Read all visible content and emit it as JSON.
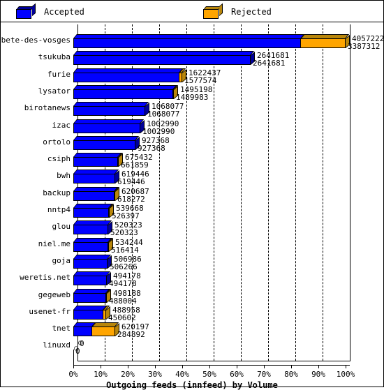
{
  "legend": {
    "items": [
      {
        "label": "Accepted",
        "color": "#0000ff",
        "side_color": "#000099",
        "icon": "cube-icon"
      },
      {
        "label": "Rejected",
        "color": "#ffa500",
        "side_color": "#b8860b",
        "icon": "cube-icon"
      }
    ]
  },
  "chart_data": {
    "type": "bar",
    "orientation": "horizontal",
    "stacked": false,
    "title": "",
    "xlabel": "Outgoing feeds (innfeed) by Volume",
    "ylabel": "",
    "xticks": [
      "0%",
      "10%",
      "20%",
      "30%",
      "40%",
      "50%",
      "60%",
      "70%",
      "80%",
      "90%",
      "100%"
    ],
    "xtick_values": [
      0,
      10,
      20,
      30,
      40,
      50,
      60,
      70,
      80,
      90,
      100
    ],
    "xlim": [
      0,
      100
    ],
    "grid": true,
    "legend_position": "top",
    "scale_reference": 4057222,
    "categories": [
      "bete-des-vosges",
      "tsukuba",
      "furie",
      "lysator",
      "birotanews",
      "izac",
      "ortolo",
      "csiph",
      "bwh",
      "backup",
      "nntp4",
      "glou",
      "niel.me",
      "goja",
      "weretis.net",
      "gegeweb",
      "usenet-fr",
      "tnet",
      "linuxd"
    ],
    "series": [
      {
        "name": "Accepted",
        "color": "#0000ff",
        "values": [
          4057222,
          2641681,
          1622437,
          1495198,
          1068077,
          1002990,
          927368,
          675432,
          619446,
          620687,
          539668,
          520323,
          534244,
          506986,
          494178,
          498188,
          488958,
          620197,
          0
        ]
      },
      {
        "name": "Rejected",
        "color": "#ffa500",
        "values": [
          3387312,
          2641681,
          1577574,
          1489983,
          1068077,
          1002990,
          927368,
          661859,
          619446,
          618272,
          526397,
          520323,
          516414,
          506266,
          494178,
          488004,
          450602,
          284892,
          0
        ]
      }
    ],
    "labels": [
      {
        "category": "bete-des-vosges",
        "accepted": "4057222",
        "rejected": "3387312"
      },
      {
        "category": "tsukuba",
        "accepted": "2641681",
        "rejected": "2641681"
      },
      {
        "category": "furie",
        "accepted": "1622437",
        "rejected": "1577574"
      },
      {
        "category": "lysator",
        "accepted": "1495198",
        "rejected": "1489983"
      },
      {
        "category": "birotanews",
        "accepted": "1068077",
        "rejected": "1068077"
      },
      {
        "category": "izac",
        "accepted": "1002990",
        "rejected": "1002990"
      },
      {
        "category": "ortolo",
        "accepted": "927368",
        "rejected": "927368"
      },
      {
        "category": "csiph",
        "accepted": "675432",
        "rejected": "661859"
      },
      {
        "category": "bwh",
        "accepted": "619446",
        "rejected": "619446"
      },
      {
        "category": "backup",
        "accepted": "620687",
        "rejected": "618272"
      },
      {
        "category": "nntp4",
        "accepted": "539668",
        "rejected": "526397"
      },
      {
        "category": "glou",
        "accepted": "520323",
        "rejected": "520323"
      },
      {
        "category": "niel.me",
        "accepted": "534244",
        "rejected": "516414"
      },
      {
        "category": "goja",
        "accepted": "506986",
        "rejected": "506266"
      },
      {
        "category": "weretis.net",
        "accepted": "494178",
        "rejected": "494178"
      },
      {
        "category": "gegeweb",
        "accepted": "498188",
        "rejected": "488004"
      },
      {
        "category": "usenet-fr",
        "accepted": "488958",
        "rejected": "450602"
      },
      {
        "category": "tnet",
        "accepted": "620197",
        "rejected": "284892"
      },
      {
        "category": "linuxd",
        "accepted": "0",
        "rejected": "0"
      }
    ]
  }
}
